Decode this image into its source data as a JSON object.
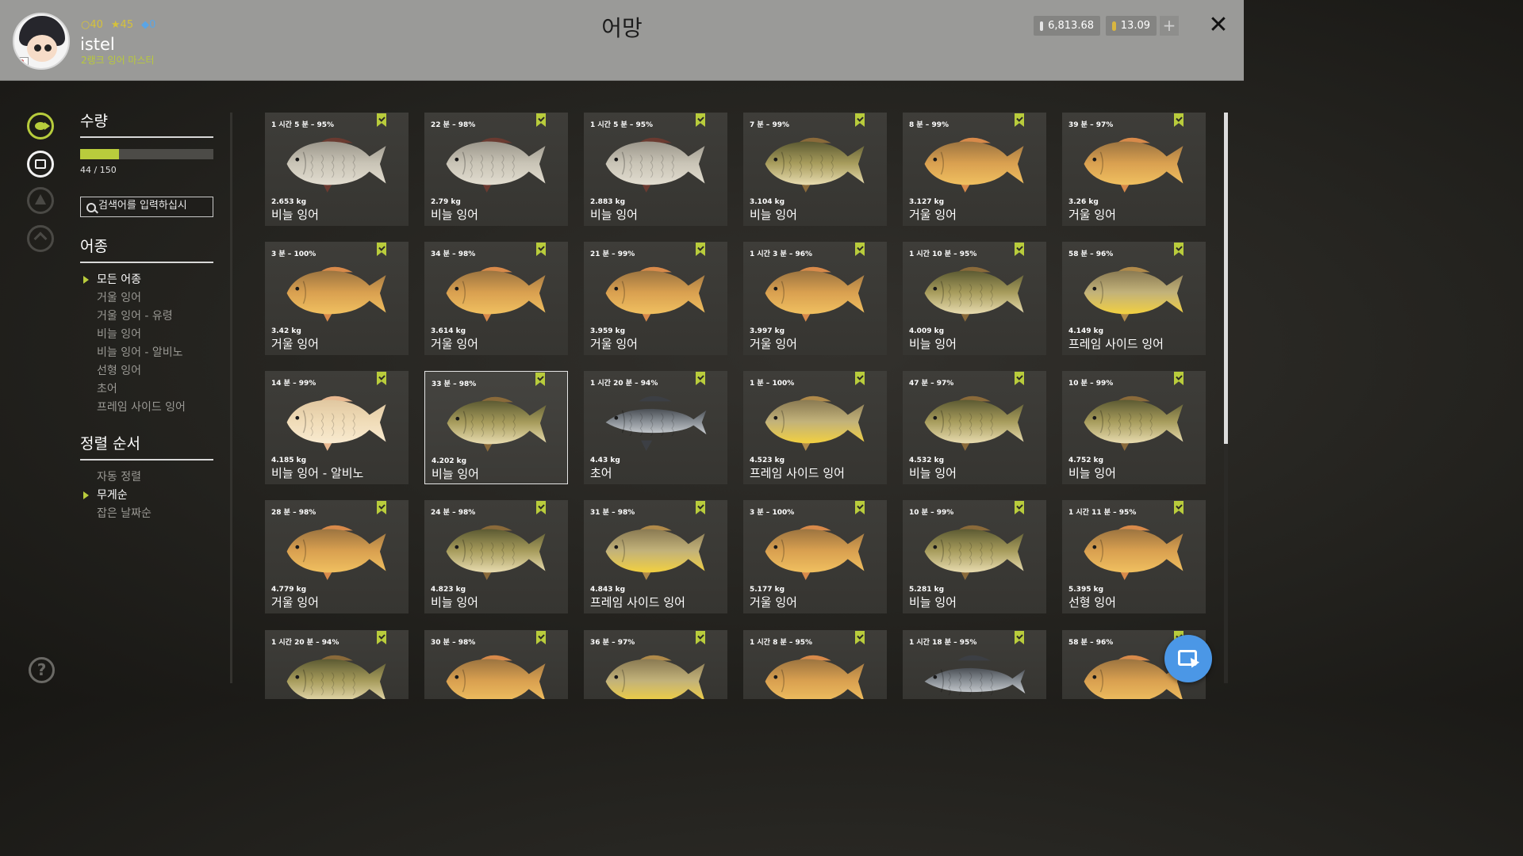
{
  "header": {
    "title": "어망",
    "username": "istel",
    "rank": "2랭크 잉어 마스터",
    "stats": {
      "gold": "40",
      "stars": "45",
      "shield": "0"
    },
    "silver": "6,813.68",
    "gold_coins": "13.09",
    "plus_label": "+",
    "close_label": "✕"
  },
  "sidebar": {
    "quantity_title": "수량",
    "quantity_text": "44 / 150",
    "quantity_fraction": 0.293,
    "search_placeholder": "검색어를 입력하십시",
    "species_title": "어종",
    "species": [
      "모든 어종",
      "거울 잉어",
      "거울 잉어 - 유령",
      "비늘 잉어",
      "비늘 잉어 - 알비노",
      "선형 잉어",
      "초어",
      "프레임 사이드 잉어"
    ],
    "species_selected": 0,
    "sort_title": "정렬 순서",
    "sort": [
      "자동 정렬",
      "무게순",
      "잡은 날짜순"
    ],
    "sort_selected": 1,
    "help_label": "?"
  },
  "colors": {
    "accent": "#b9cc3c",
    "cursor_button": "#4b97e6"
  },
  "catches": [
    {
      "time": "1 시간 5 분 – 95%",
      "weight": "2.653 kg",
      "name": "비늘 잉어",
      "kind": "silver"
    },
    {
      "time": "22 분 – 98%",
      "weight": "2.79 kg",
      "name": "비늘 잉어",
      "kind": "silver"
    },
    {
      "time": "1 시간 5 분 – 95%",
      "weight": "2.883 kg",
      "name": "비늘 잉어",
      "kind": "silver"
    },
    {
      "time": "7 분 – 99%",
      "weight": "3.104 kg",
      "name": "비늘 잉어",
      "kind": "common"
    },
    {
      "time": "8 분 – 99%",
      "weight": "3.127 kg",
      "name": "거울 잉어",
      "kind": "mirror"
    },
    {
      "time": "39 분 – 97%",
      "weight": "3.26 kg",
      "name": "거울 잉어",
      "kind": "mirror"
    },
    {
      "time": "3 분 – 100%",
      "weight": "3.42 kg",
      "name": "거울 잉어",
      "kind": "mirror"
    },
    {
      "time": "34 분 – 98%",
      "weight": "3.614 kg",
      "name": "거울 잉어",
      "kind": "mirror"
    },
    {
      "time": "21 분 – 99%",
      "weight": "3.959 kg",
      "name": "거울 잉어",
      "kind": "mirror"
    },
    {
      "time": "1 시간 3 분 – 96%",
      "weight": "3.997 kg",
      "name": "거울 잉어",
      "kind": "mirror"
    },
    {
      "time": "1 시간 10 분 – 95%",
      "weight": "4.009 kg",
      "name": "비늘 잉어",
      "kind": "common"
    },
    {
      "time": "58 분 – 96%",
      "weight": "4.149 kg",
      "name": "프레임 사이드 잉어",
      "kind": "frame"
    },
    {
      "time": "14 분 – 99%",
      "weight": "4.185 kg",
      "name": "비늘 잉어 - 알비노",
      "kind": "albino"
    },
    {
      "time": "33 분 – 98%",
      "weight": "4.202 kg",
      "name": "비늘 잉어",
      "kind": "common",
      "highlighted": true
    },
    {
      "time": "1 시간 20 분 – 94%",
      "weight": "4.43 kg",
      "name": "초어",
      "kind": "grass"
    },
    {
      "time": "1 분 – 100%",
      "weight": "4.523 kg",
      "name": "프레임 사이드 잉어",
      "kind": "frame"
    },
    {
      "time": "47 분 – 97%",
      "weight": "4.532 kg",
      "name": "비늘 잉어",
      "kind": "common"
    },
    {
      "time": "10 분 – 99%",
      "weight": "4.752 kg",
      "name": "비늘 잉어",
      "kind": "common"
    },
    {
      "time": "28 분 – 98%",
      "weight": "4.779 kg",
      "name": "거울 잉어",
      "kind": "mirror"
    },
    {
      "time": "24 분 – 98%",
      "weight": "4.823 kg",
      "name": "비늘 잉어",
      "kind": "common"
    },
    {
      "time": "31 분 – 98%",
      "weight": "4.843 kg",
      "name": "프레임 사이드 잉어",
      "kind": "frame"
    },
    {
      "time": "3 분 – 100%",
      "weight": "5.177 kg",
      "name": "거울 잉어",
      "kind": "mirror"
    },
    {
      "time": "10 분 – 99%",
      "weight": "5.281 kg",
      "name": "비늘 잉어",
      "kind": "common"
    },
    {
      "time": "1 시간 11 분 – 95%",
      "weight": "5.395 kg",
      "name": "선형 잉어",
      "kind": "mirror"
    },
    {
      "time": "1 시간 20 분 – 94%",
      "weight": "",
      "name": "",
      "kind": "common"
    },
    {
      "time": "30 분 – 98%",
      "weight": "",
      "name": "",
      "kind": "mirror"
    },
    {
      "time": "36 분 – 97%",
      "weight": "",
      "name": "",
      "kind": "frame"
    },
    {
      "time": "1 시간 8 분 – 95%",
      "weight": "",
      "name": "",
      "kind": "mirror"
    },
    {
      "time": "1 시간 18 분 – 95%",
      "weight": "",
      "name": "",
      "kind": "grass"
    },
    {
      "time": "58 분 – 96%",
      "weight": "",
      "name": "",
      "kind": "mirror"
    }
  ]
}
